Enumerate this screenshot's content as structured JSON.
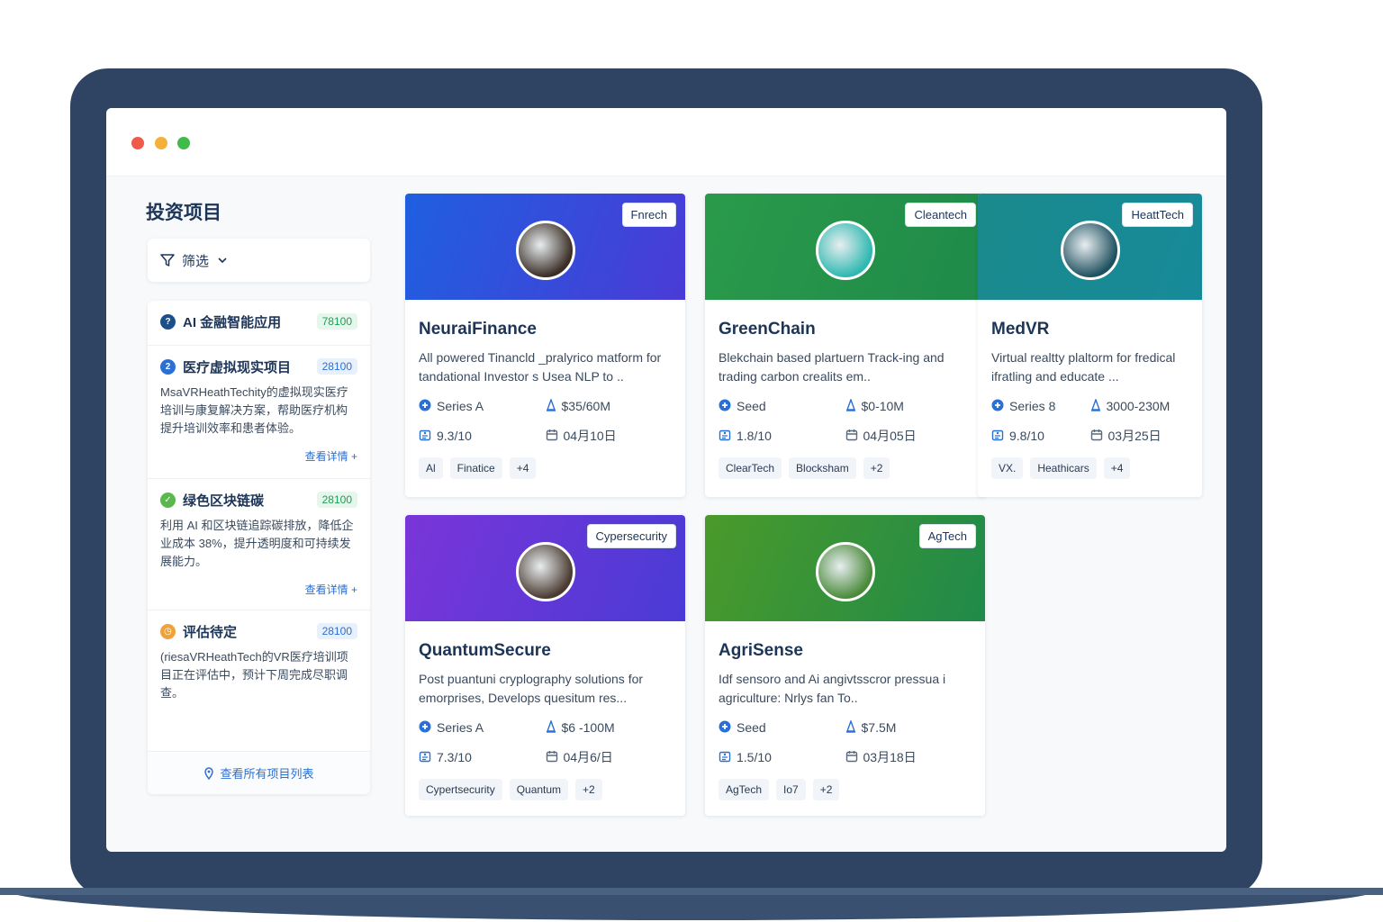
{
  "sidebar": {
    "title": "投资项目",
    "filter_label": "筛选",
    "items": [
      {
        "title": "AI 金融智能应用",
        "number": "78100",
        "number_color": "#1f9d55",
        "number_bg": "#e6f6ec",
        "icon_color": "#1c4f8a",
        "icon_glyph": "?",
        "desc": "",
        "link": ""
      },
      {
        "title": "医疗虚拟现实项目",
        "number": "28100",
        "number_color": "#2a6fd6",
        "number_bg": "#e8f0fc",
        "icon_color": "#2a6fd6",
        "icon_glyph": "2",
        "desc": "MsaVRHeathTechity的虚拟现实医疗培训与康复解决方案，帮助医疗机构提升培训效率和患者体验。",
        "link": "查看详情 +"
      },
      {
        "title": "绿色区块链碳",
        "number": "28100",
        "number_color": "#1f9d55",
        "number_bg": "#e6f6ec",
        "icon_color": "#5bb84d",
        "icon_glyph": "✓",
        "desc": "利用 AI 和区块链追踪碳排放，降低企业成本 38%，提升透明度和可持续发展能力。",
        "link": "查看详情 +"
      },
      {
        "title": "评估待定",
        "number": "28100",
        "number_color": "#2a6fd6",
        "number_bg": "#e8f0fc",
        "icon_color": "#f0a23a",
        "icon_glyph": "◷",
        "desc": "(riesaVRHeathTech的VR医疗培训项目正在评估中，预计下周完成尽职调查。",
        "link": ""
      }
    ],
    "footer_label": "查看所有项目列表"
  },
  "cards": [
    {
      "tag": "Fnrech",
      "title": "NeuraiFinance",
      "desc": "All powered Tinancld _pralyrico matform for tandational Investor s Usea NLP to ..",
      "stage": "Series A",
      "amount": "$35/60M",
      "score": "9.3/10",
      "date": "04月10日",
      "chips": [
        "Al",
        "Finatice",
        "+4"
      ],
      "banner_from": "#1f5fe0",
      "banner_to": "#4a3bd6",
      "avatar_color": "#3a2d25"
    },
    {
      "tag": "Cleantech",
      "title": "GreenChain",
      "desc": "Blekchain based plartuern Track-ing and trading carbon crealits em..",
      "stage": "Seed",
      "amount": "$0-10M",
      "score": "1.8/10",
      "date": "04月05日",
      "chips": [
        "ClearTech",
        "Blocksham",
        "+2"
      ],
      "banner_from": "#2a9a4a",
      "banner_to": "#1f8a4a",
      "avatar_color": "#2fb8b0"
    },
    {
      "tag": "HeattTech",
      "title": "MedVR",
      "desc": "Virtual realtty plaltorm for fredical ifratling and educate ...",
      "stage": "Series 8",
      "amount": "3000-230M",
      "score": "9.8/10",
      "date": "03月25日",
      "chips": [
        "VX.",
        "Heathicars",
        "+4"
      ],
      "banner_from": "#1a8a8c",
      "banner_to": "#178a9a",
      "avatar_color": "#1f5060"
    },
    {
      "tag": "Cypersecurity",
      "title": "QuantumSecure",
      "desc": "Post puantuni cryplography solutions for emorprises, Develops quesitum res...",
      "stage": "Series A",
      "amount": "$6 -100M",
      "score": "7.3/10",
      "date": "04月6/日",
      "chips": [
        "Cypertsecurity",
        "Quantum",
        "+2"
      ],
      "banner_from": "#7a35d8",
      "banner_to": "#4a3bd6",
      "avatar_color": "#4a3a30"
    },
    {
      "tag": "AgTech",
      "title": "AgriSense",
      "desc": "Idf sensoro and Ai angivtsscror pressua i agriculture: Nrlys fan To..",
      "stage": "Seed",
      "amount": "$7.5M",
      "score": "1.5/10",
      "date": "03月18日",
      "chips": [
        "AgTech",
        "Io7",
        "+2"
      ],
      "banner_from": "#4a9a2a",
      "banner_to": "#1f8a4a",
      "avatar_color": "#4a8a3a"
    }
  ]
}
